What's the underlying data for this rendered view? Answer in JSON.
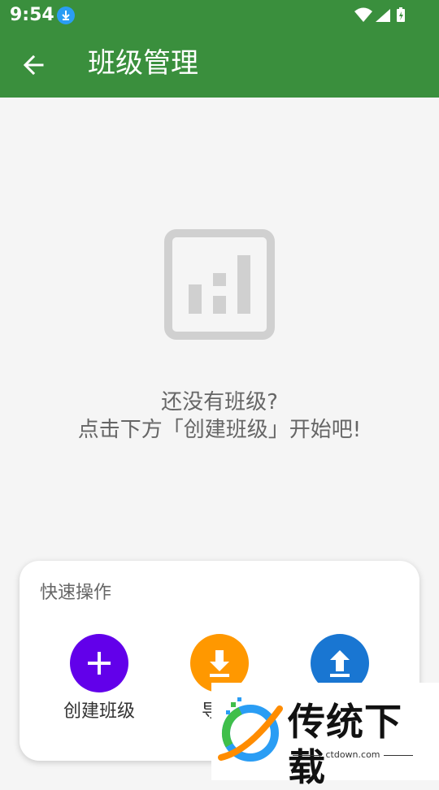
{
  "status_bar": {
    "time": "9:54"
  },
  "app_bar": {
    "title": "班级管理"
  },
  "empty_state": {
    "line1": "还没有班级?",
    "line2": "点击下方「创建班级」开始吧!"
  },
  "quick_actions": {
    "title": "快速操作",
    "actions": [
      {
        "label": "创建班级",
        "color": "#6200ea",
        "icon": "plus-icon"
      },
      {
        "label": "导出",
        "color": "#ff9800",
        "icon": "download-icon"
      },
      {
        "label": "",
        "color": "#1976d2",
        "icon": "upload-icon"
      }
    ]
  },
  "watermark": {
    "text": "传统下载",
    "url": "ctdown.com"
  },
  "colors": {
    "app_bar": "#3a8f3d",
    "background": "#f5f5f5"
  }
}
